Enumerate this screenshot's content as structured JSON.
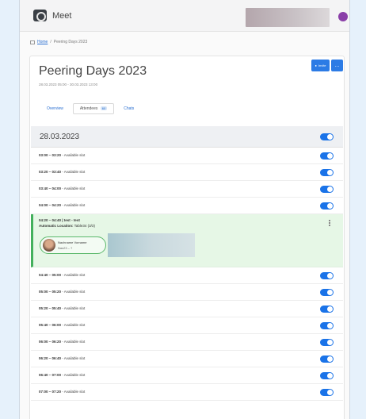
{
  "app": {
    "title": "Meet"
  },
  "breadcrumb": {
    "home": "Home",
    "separator": "/",
    "current": "Peering Days 2023"
  },
  "event": {
    "title": "Peering Days 2023",
    "date_range": "28.03.2023 05:00 - 30.03.2023 13:00",
    "invite_label": "Invite",
    "more_label": "…"
  },
  "tabs": [
    {
      "label": "Overview",
      "active": false
    },
    {
      "label": "Attendees",
      "badge": "60",
      "active": true
    },
    {
      "label": "Chats",
      "active": false
    }
  ],
  "day": {
    "label": "28.03.2023",
    "enabled": true
  },
  "slots_before": [
    {
      "time": "03:00 – 03:20",
      "status": "Available slot",
      "enabled": true
    },
    {
      "time": "03:20 – 03:40",
      "status": "Available slot",
      "enabled": true
    },
    {
      "time": "03:40 – 04:00",
      "status": "Available slot",
      "enabled": true
    },
    {
      "time": "04:00 – 04:20",
      "status": "Available slot",
      "enabled": true
    }
  ],
  "booked": {
    "time": "04:20 – 04:40",
    "title": "test",
    "status": "test",
    "location_label": "Automatic Location:",
    "location_value": "Table34 (3/3)",
    "participant_name": "Nachname Vorname",
    "participant_sub": "Nas23 – ?"
  },
  "slots_after": [
    {
      "time": "04:40 – 05:00",
      "status": "Available slot",
      "enabled": true
    },
    {
      "time": "05:00 – 05:20",
      "status": "Available slot",
      "enabled": true
    },
    {
      "time": "05:20 – 05:40",
      "status": "Available slot",
      "enabled": true
    },
    {
      "time": "05:40 – 06:00",
      "status": "Available slot",
      "enabled": true
    },
    {
      "time": "06:00 – 06:20",
      "status": "Available slot",
      "enabled": true
    },
    {
      "time": "06:20 – 06:40",
      "status": "Available slot",
      "enabled": true
    },
    {
      "time": "06:40 – 07:00",
      "status": "Available slot",
      "enabled": true
    },
    {
      "time": "07:00 – 07:20",
      "status": "Available slot",
      "enabled": true
    }
  ],
  "colors": {
    "accent": "#1a73e8",
    "booked_bg": "#e6f7e6",
    "booked_border": "#43b05c"
  }
}
